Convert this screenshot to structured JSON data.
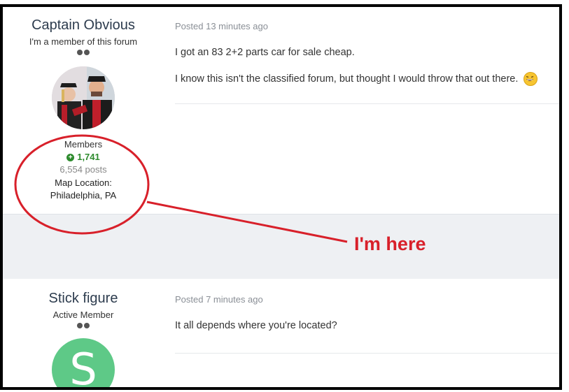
{
  "posts": [
    {
      "author": {
        "name": "Captain Obvious",
        "title": "I'm a member of this forum",
        "group": "Members",
        "reputation": "1,741",
        "post_count": "6,554 posts",
        "location_label": "Map Location:",
        "location": "Philadelphia, PA"
      },
      "meta": "Posted 13 minutes ago",
      "paragraphs": [
        "I got an 83 2+2 parts car for sale cheap.",
        "I know this isn't the classified forum, but thought I would throw that out there."
      ]
    },
    {
      "author": {
        "name": "Stick figure",
        "title": "Active Member",
        "avatar_letter": "S"
      },
      "meta": "Posted 7 minutes ago",
      "paragraphs": [
        "It all depends where you're located?"
      ]
    }
  ],
  "annotation": {
    "text": "I'm here",
    "color": "#d8202a"
  },
  "colors": {
    "reputation_green": "#2e8b2e",
    "avatar_green": "#5ec987"
  },
  "icons": {
    "reputation": "plus-circle-icon",
    "emoji": "laughing-emoji-icon"
  }
}
